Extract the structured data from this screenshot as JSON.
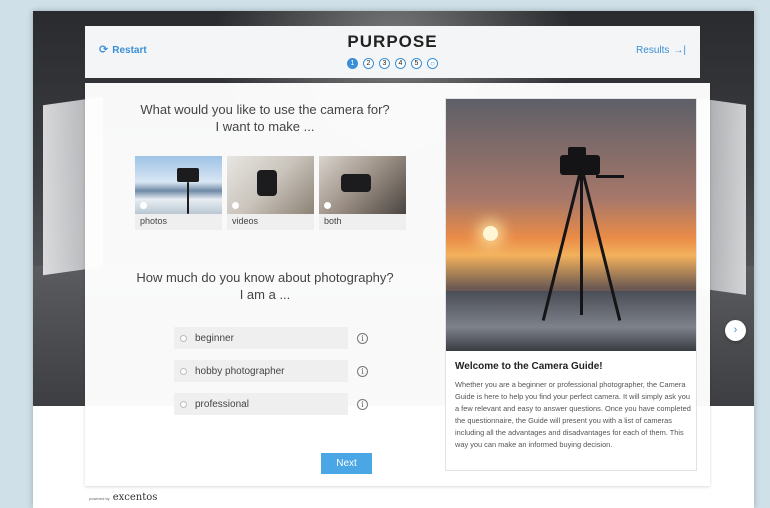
{
  "header": {
    "restart_label": "Restart",
    "title": "PURPOSE",
    "results_label": "Results",
    "steps": [
      "1",
      "2",
      "3",
      "4",
      "5"
    ],
    "final_step_glyph": "○"
  },
  "question1": {
    "line1": "What would you like to use the camera for?",
    "line2": "I want to make ...",
    "options": [
      "photos",
      "videos",
      "both"
    ]
  },
  "question2": {
    "line1": "How much do you know about photography?",
    "line2": "I am a ...",
    "options": [
      "beginner",
      "hobby photographer",
      "professional"
    ]
  },
  "next_label": "Next",
  "info_card": {
    "title": "Welcome to the Camera Guide!",
    "body": "Whether you are a beginner or professional photographer, the Camera Guide is here to help you find your perfect camera. It will simply ask you a few relevant and easy to answer questions. Once you have completed the questionnaire, the Guide will present you with a list of cameras including all the advantages and disadvantages for each of them. This way you can make an informed buying decision."
  },
  "footer": {
    "powered_by": "powered by",
    "brand": "excentos"
  },
  "icons": {
    "restart": "refresh-icon",
    "results": "arrow-right-bar-icon",
    "info": "info-icon",
    "carousel": "chevron-right-icon"
  },
  "colors": {
    "accent": "#3a8fd6",
    "button": "#4aa6e4"
  }
}
